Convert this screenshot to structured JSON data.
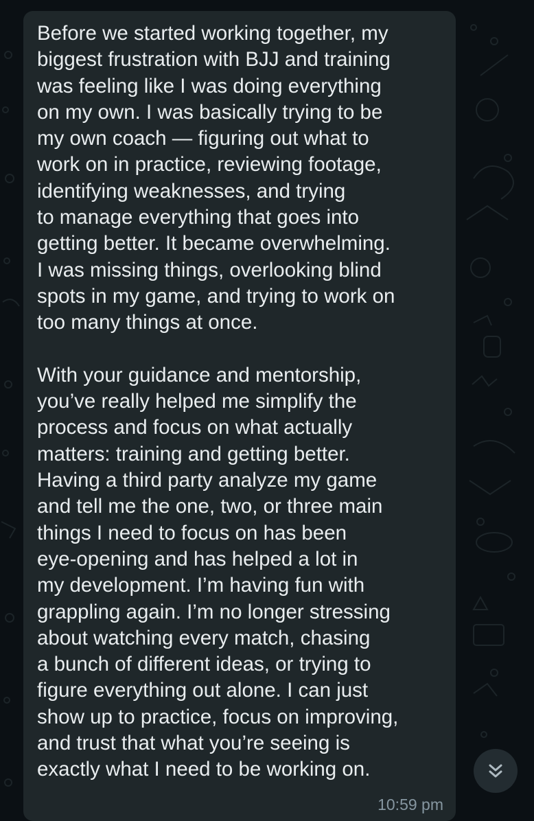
{
  "message": {
    "lines": [
      "Before we started working together, my",
      "biggest frustration with BJJ and training",
      "was feeling like I was doing everything",
      "on my own. I was basically trying to be",
      "my own coach — figuring out what to",
      "work on in practice, reviewing footage,",
      "identifying weaknesses, and trying",
      "to manage everything that goes into",
      "getting better. It became overwhelming.",
      "I was missing things, overlooking blind",
      "spots in my game, and trying to work on",
      "too many things at once.",
      "",
      "With your guidance and mentorship,",
      "you’ve really helped me simplify the",
      "process and focus on what actually",
      "matters: training and getting better.",
      "Having a third party analyze my game",
      "and tell me the one, two, or three main",
      "things I need to focus on has been",
      "eye-opening and has helped a lot in",
      "my development. I’m having fun with",
      "grappling again. I’m no longer stressing",
      "about watching every match, chasing",
      "a bunch of different ideas, or trying to",
      "figure everything out alone. I can just",
      "show up to practice, focus on improving,",
      "and trust that what you’re seeing is",
      "exactly what I need to be working on."
    ],
    "timestamp": "10:59 pm"
  },
  "scroll_button": {
    "icon": "double-chevron-down-icon"
  },
  "colors": {
    "background": "#0b1014",
    "bubble": "#1f272a",
    "text": "#e9edef",
    "timestamp": "#8696a0",
    "scroll_button": "#232c31"
  }
}
